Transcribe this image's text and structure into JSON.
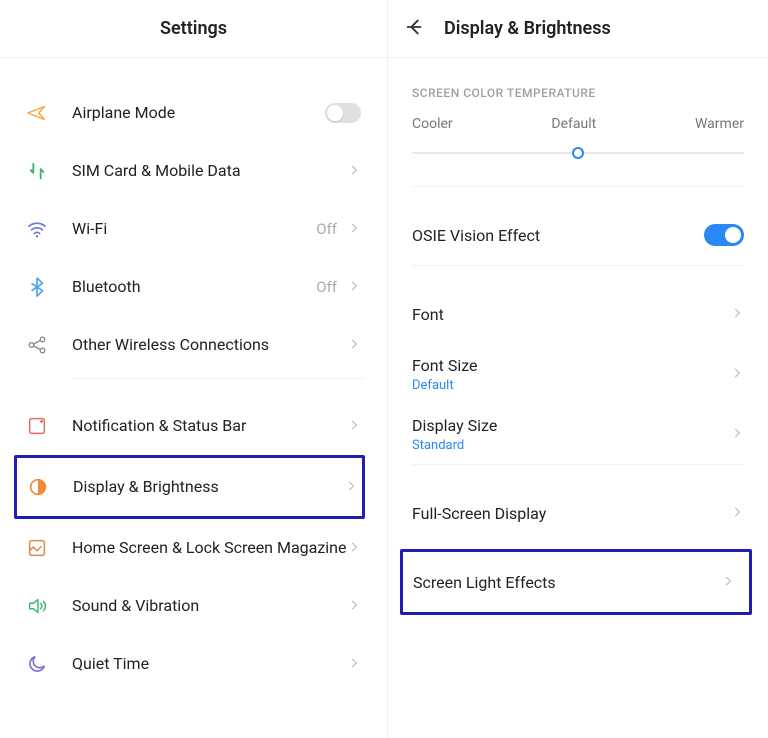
{
  "left": {
    "title": "Settings",
    "items": [
      {
        "label": "Airplane Mode",
        "icon": "airplane",
        "toggle": false
      },
      {
        "label": "SIM Card & Mobile Data",
        "icon": "sim",
        "chevron": true
      },
      {
        "label": "Wi-Fi",
        "icon": "wifi",
        "status": "Off",
        "chevron": true
      },
      {
        "label": "Bluetooth",
        "icon": "bluetooth",
        "status": "Off",
        "chevron": true
      },
      {
        "label": "Other Wireless Connections",
        "icon": "link",
        "chevron": true
      },
      {
        "label": "Notification & Status Bar",
        "icon": "notif",
        "chevron": true
      },
      {
        "label": "Display & Brightness",
        "icon": "display",
        "chevron": true,
        "highlight": true
      },
      {
        "label": "Home Screen & Lock Screen Magazine",
        "icon": "home",
        "chevron": true
      },
      {
        "label": "Sound & Vibration",
        "icon": "sound",
        "chevron": true
      },
      {
        "label": "Quiet Time",
        "icon": "moon",
        "chevron": true
      }
    ]
  },
  "right": {
    "title": "Display & Brightness",
    "colorTemp": {
      "title": "SCREEN COLOR TEMPERATURE",
      "cooler": "Cooler",
      "default": "Default",
      "warmer": "Warmer"
    },
    "osie": {
      "label": "OSIE Vision Effect",
      "on": true
    },
    "font": {
      "label": "Font"
    },
    "fontSize": {
      "label": "Font Size",
      "value": "Default"
    },
    "displaySize": {
      "label": "Display Size",
      "value": "Standard"
    },
    "fullScreen": {
      "label": "Full-Screen Display"
    },
    "screenLight": {
      "label": "Screen Light Effects",
      "highlight": true
    }
  }
}
